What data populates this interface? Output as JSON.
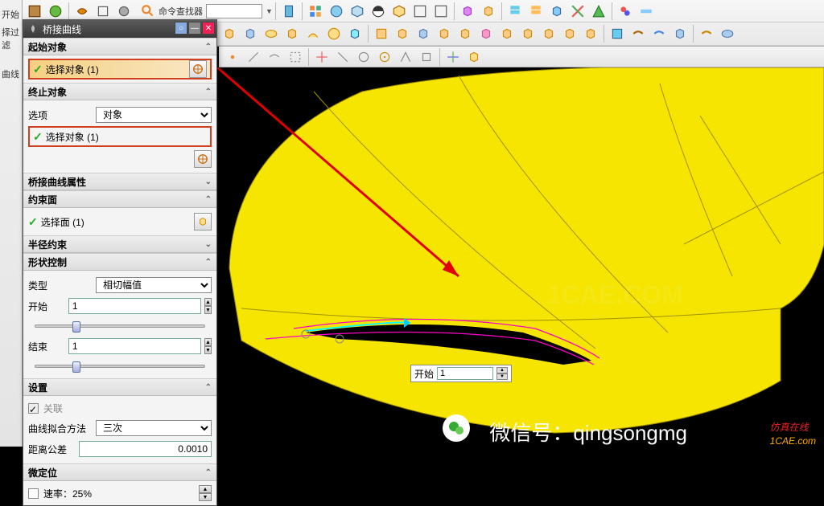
{
  "app": {
    "command_finder_label": "命令查找器"
  },
  "left_margin": {
    "start": "开始",
    "filter": "择过滤",
    "curve": "曲线"
  },
  "dialog": {
    "title": "桥接曲线",
    "sections": {
      "start_obj": "起始对象",
      "end_obj": "终止对象",
      "options_label": "选项",
      "options_value": "对象",
      "select_obj_1": "选择对象 (1)",
      "select_obj_2": "选择对象 (1)",
      "bridge_attr": "桥接曲线属性",
      "constraint_face": "约束面",
      "select_face": "选择面 (1)",
      "radius_constraint": "半径约束",
      "shape_control": "形状控制",
      "type_label": "类型",
      "type_value": "相切幅值",
      "start_label": "开始",
      "start_value": "1",
      "end_label": "结束",
      "end_value": "1",
      "settings": "设置",
      "relevance": "关联",
      "fit_method_label": "曲线拟合方法",
      "fit_method_value": "三次",
      "tolerance_label": "距离公差",
      "tolerance_value": "0.0010",
      "micro": "微定位",
      "speed_label": "速率：25%"
    }
  },
  "viewport": {
    "float_label": "开始",
    "float_value": "1"
  },
  "watermark": {
    "center": "1CAE.COM",
    "wechat": "微信号：qingsongmg",
    "br1": "仿真在线",
    "br2": "1CAE.com"
  }
}
